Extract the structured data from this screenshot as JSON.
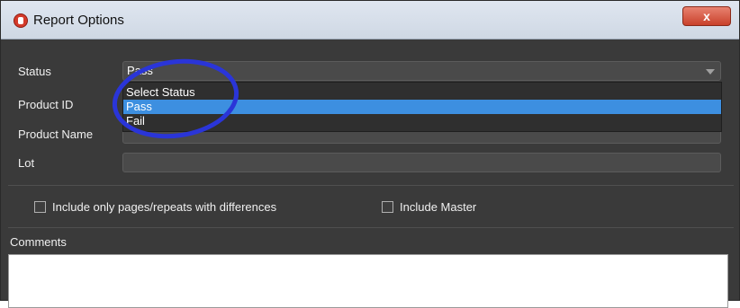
{
  "window": {
    "title": "Report Options",
    "close_label": "x"
  },
  "form": {
    "status_label": "Status",
    "status_value": "Pass",
    "product_id_label": "Product ID",
    "product_name_label": "Product Name",
    "lot_label": "Lot"
  },
  "status_options": [
    "Select Status",
    "Pass",
    "Fail"
  ],
  "checkboxes": {
    "differences_label": "Include only pages/repeats with differences",
    "master_label": "Include Master"
  },
  "comments": {
    "label": "Comments"
  },
  "colors": {
    "highlight": "#3d8fe0",
    "annotation_circle": "#2a35d8",
    "close": "#c9412b"
  }
}
